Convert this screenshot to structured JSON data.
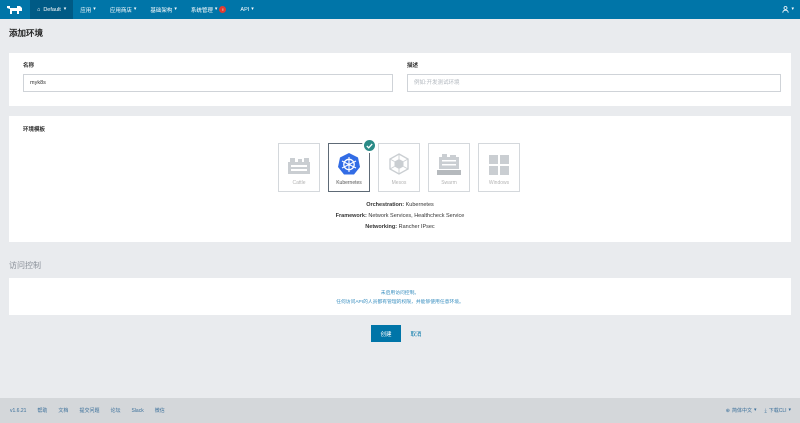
{
  "topbar": {
    "environment": "Default",
    "nav": [
      {
        "label": "应用",
        "badge": null
      },
      {
        "label": "应用商店",
        "badge": null
      },
      {
        "label": "基础架构",
        "badge": null
      },
      {
        "label": "系统管理",
        "badge": "!"
      },
      {
        "label": "API",
        "badge": null
      }
    ]
  },
  "page": {
    "title": "添加环境"
  },
  "form": {
    "name_label": "名称",
    "name_value": "myk8s",
    "desc_label": "描述",
    "desc_placeholder": "例如:开发测试环境"
  },
  "templates": {
    "title": "环境模板",
    "items": [
      {
        "label": "Cattle",
        "selected": false
      },
      {
        "label": "Kubernetes",
        "selected": true
      },
      {
        "label": "Mesos",
        "selected": false
      },
      {
        "label": "Swarm",
        "selected": false
      },
      {
        "label": "Windows",
        "selected": false
      }
    ],
    "info": {
      "orchestration_key": "Orchestration:",
      "orchestration_val": "Kubernetes",
      "framework_key": "Framework:",
      "framework_val": "Network Services, Healthcheck Service",
      "networking_key": "Networking:",
      "networking_val": "Rancher IPsec"
    }
  },
  "access": {
    "title": "访问控制",
    "line1": "未启用访问控制。",
    "line2": "任何访问API的人员都有管理的权限，并能够使用任意环境。"
  },
  "buttons": {
    "create": "创建",
    "cancel": "取消"
  },
  "footer": {
    "version": "v1.6.21",
    "links": [
      "帮助",
      "文档",
      "提交问题",
      "论坛",
      "Slack",
      "微信"
    ],
    "language": "简体中文",
    "cli": "下载CLI"
  },
  "colors": {
    "brand": "#0075a8",
    "check": "#2b8b87",
    "badge": "#e03c31"
  }
}
